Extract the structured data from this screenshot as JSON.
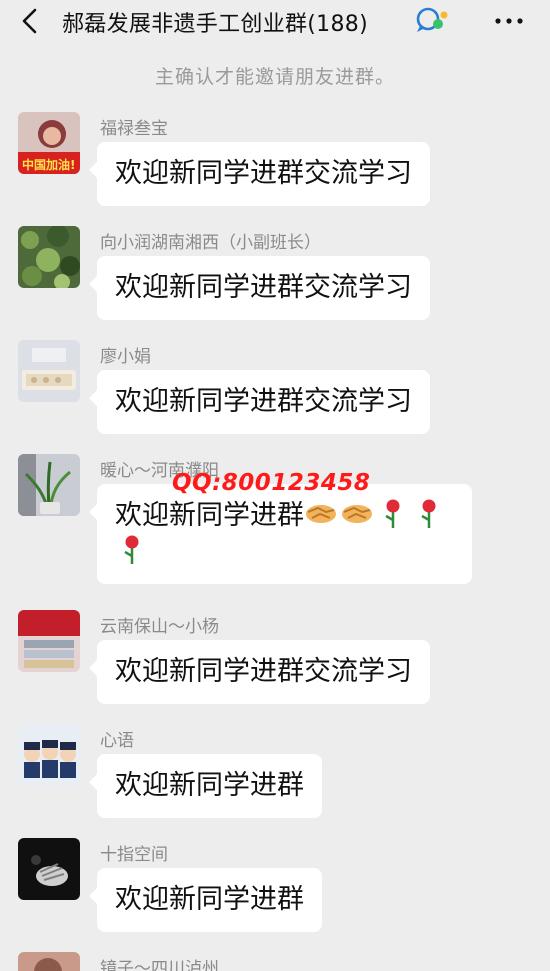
{
  "header": {
    "title": "郝磊发展非遗手工创业群(188)",
    "back_icon": "chevron-left-icon",
    "title_icon": "group-chat-icon",
    "more_icon": "ellipsis-icon"
  },
  "notice": "主确认才能邀请朋友进群。",
  "messages": [
    {
      "sender": "福禄叁宝",
      "text": "欢迎新同学进群交流学习",
      "avatar_badge": "中国加油!"
    },
    {
      "sender": "向小润湖南湘西（小副班长）",
      "text": "欢迎新同学进群交流学习"
    },
    {
      "sender": "廖小娟",
      "text": "欢迎新同学进群交流学习"
    },
    {
      "sender": "暖心～河南濮阳",
      "text": "欢迎新同学进群",
      "emojis": [
        "handshake-emoji",
        "handshake-emoji",
        "rose-emoji",
        "rose-emoji",
        "rose-emoji"
      ]
    },
    {
      "sender": "云南保山～小杨",
      "text": "欢迎新同学进群交流学习"
    },
    {
      "sender": "心语",
      "text": "欢迎新同学进群"
    },
    {
      "sender": "十指空间",
      "text": "欢迎新同学进群"
    },
    {
      "sender": "镜子～四川泸州",
      "text": ""
    }
  ],
  "watermark": "QQ:800123458",
  "colors": {
    "background": "#ededed",
    "bubble": "#ffffff",
    "sender_text": "#8a8a8a",
    "notice_text": "#9a9a9a",
    "watermark": "#ff1a1a"
  }
}
